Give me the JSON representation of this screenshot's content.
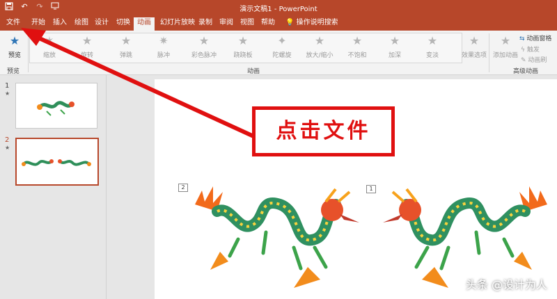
{
  "title_bar": {
    "doc_title": "演示文稿1 - PowerPoint",
    "qat": [
      "save-icon",
      "undo-icon",
      "redo-icon",
      "customize-icon"
    ]
  },
  "tabs": [
    "文件",
    "开始",
    "插入",
    "绘图",
    "设计",
    "切换",
    "动画",
    "幻灯片放映",
    "录制",
    "审阅",
    "视图",
    "帮助",
    "操作说明搜索"
  ],
  "active_tab": "动画",
  "ribbon": {
    "preview": "预览",
    "preview_group": "预览",
    "animations": [
      "缩放",
      "旋转",
      "弹跳",
      "脉冲",
      "彩色脉冲",
      "跷跷板",
      "陀螺旋",
      "放大/缩小",
      "不饱和",
      "加深",
      "变淡"
    ],
    "effect_options": "效果选项",
    "animation_group": "动画",
    "add_animation": "添加动画",
    "anim_pane": "动画窗格",
    "trigger": "触发",
    "anim_brush": "动画刷",
    "advanced_group": "高级动画"
  },
  "slides": [
    {
      "number": "1",
      "star": "★",
      "selected": false
    },
    {
      "number": "2",
      "star": "★",
      "selected": true
    }
  ],
  "canvas": {
    "tag_left": "2",
    "tag_right": "1"
  },
  "callout": {
    "text": "点击文件",
    "color": "#e01010"
  },
  "watermark": "头条 @设计为人",
  "colors": {
    "accent": "#b7472a",
    "arrow": "#e01010"
  }
}
